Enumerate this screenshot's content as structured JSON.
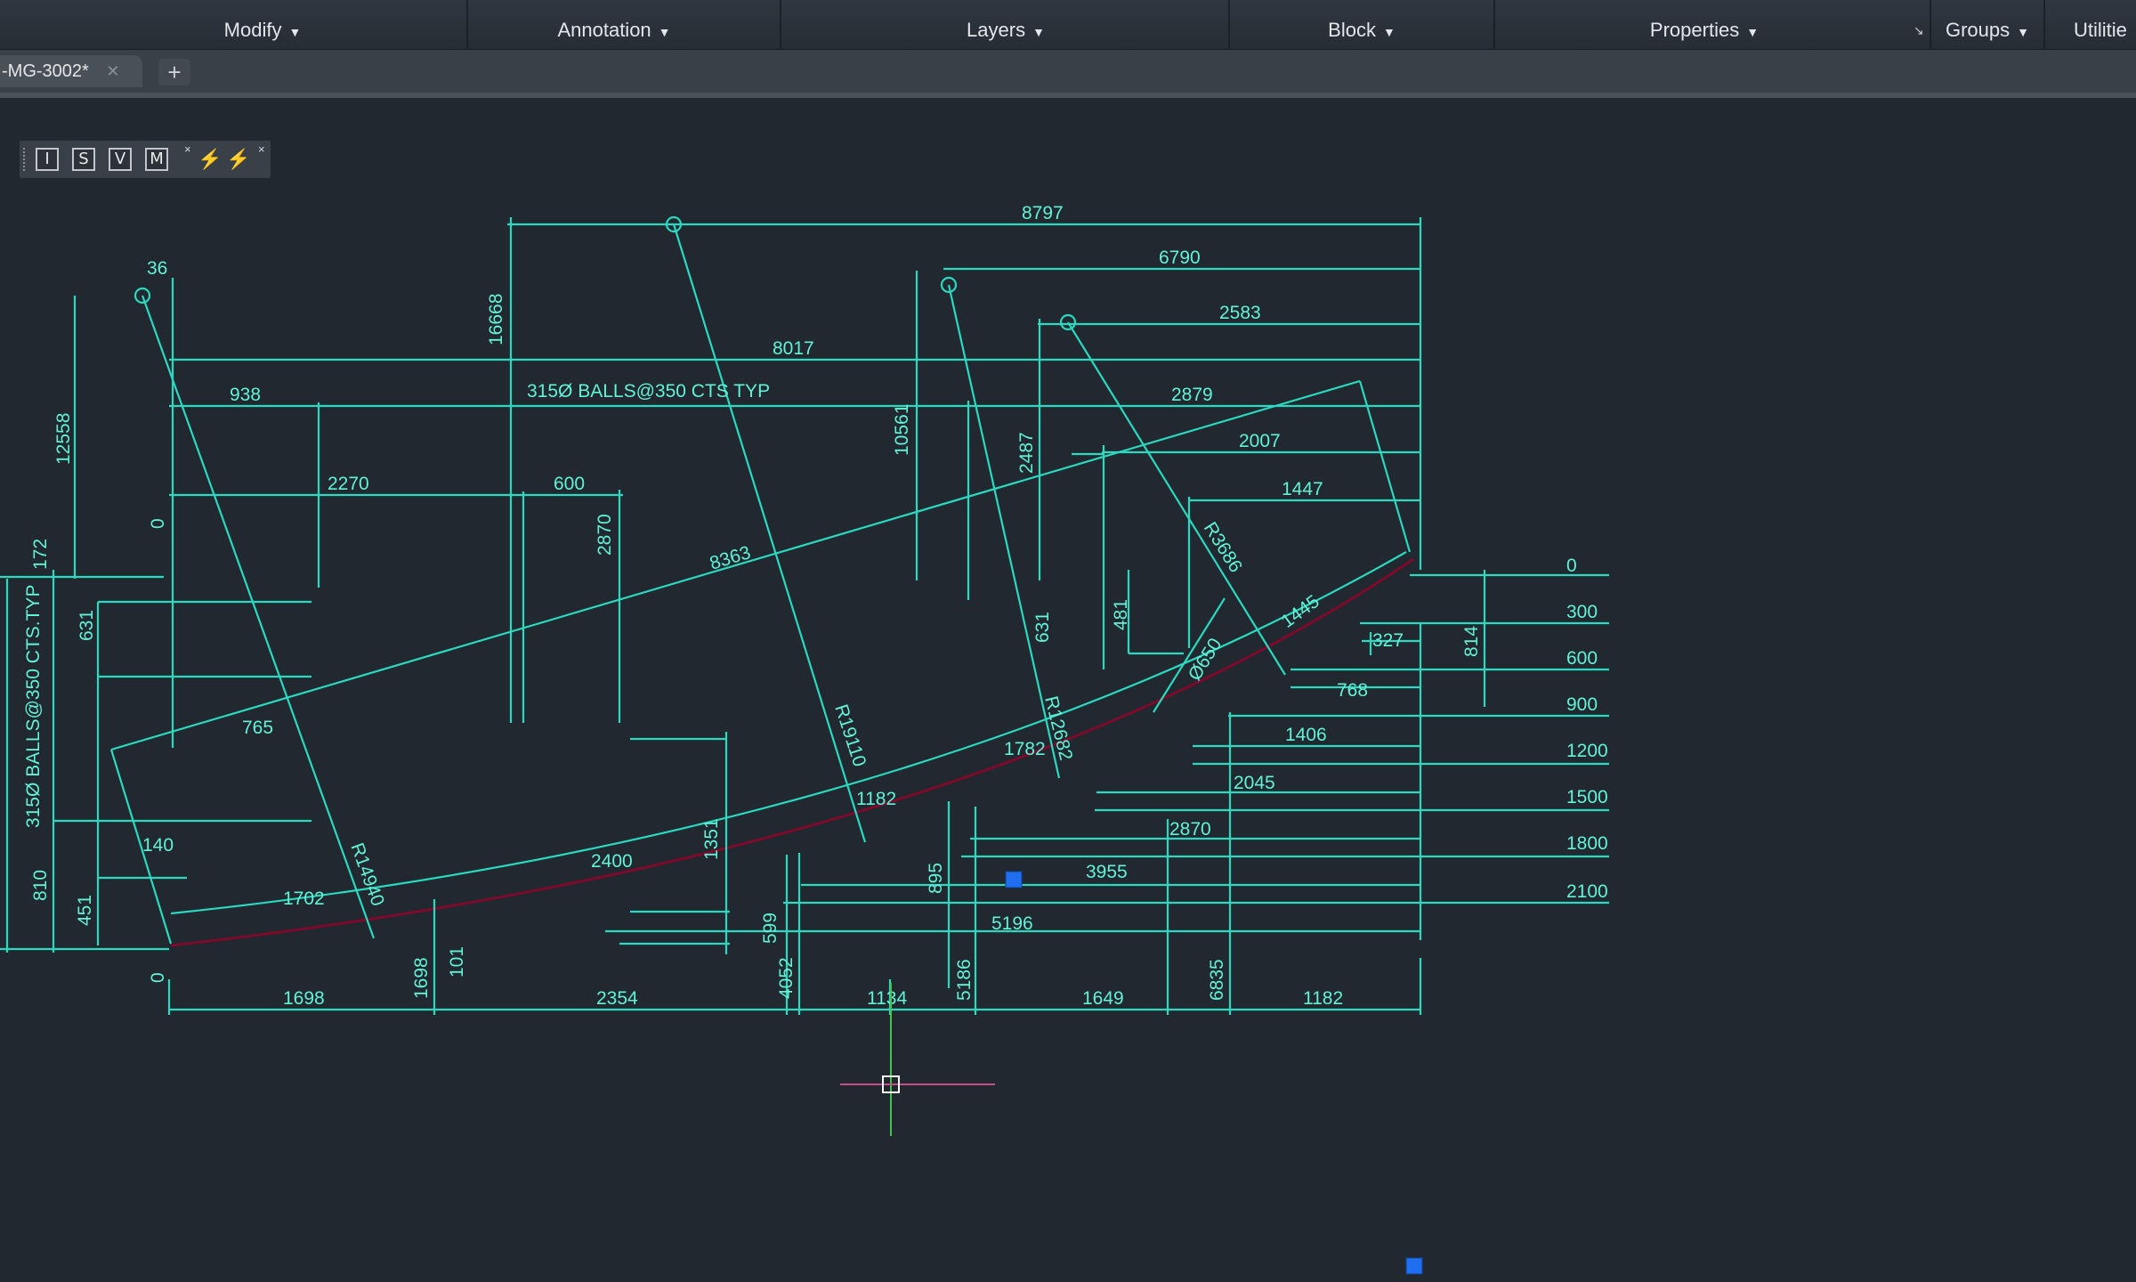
{
  "ribbon": {
    "panels": [
      {
        "label": "Modify"
      },
      {
        "label": "Annotation"
      },
      {
        "label": "Layers"
      },
      {
        "label": "Block"
      },
      {
        "label": "Properties"
      },
      {
        "label": "Groups"
      },
      {
        "label": "Utilitie"
      }
    ]
  },
  "tabs": {
    "document": "-MG-3002*",
    "close_glyph": "✕",
    "new_tab_glyph": "+"
  },
  "toolbar": {
    "buttons": [
      "I",
      "S",
      "V",
      "M"
    ],
    "close_glyph": "×"
  },
  "drawing": {
    "top_dims": [
      "36",
      "8797",
      "6790",
      "2583",
      "8017",
      "938",
      "2879",
      "2007",
      "1447",
      "2270",
      "600"
    ],
    "note": "315Ø BALLS@350 CTS TYP",
    "side_note": "315Ø BALLS@350 CTS.TYP",
    "vertical_dims": [
      "12558",
      "16668",
      "10561",
      "2487",
      "2870",
      "631",
      "631",
      "481",
      "814",
      "172",
      "810",
      "451",
      "1351",
      "895",
      "599",
      "4052",
      "5186",
      "6835",
      "1698",
      "101",
      "0",
      "0"
    ],
    "right_levels": [
      "0",
      "300",
      "600",
      "900",
      "1200",
      "1500",
      "1800",
      "2100"
    ],
    "offset_dims": [
      "327",
      "768",
      "1406",
      "2045",
      "2870",
      "3955",
      "5196"
    ],
    "radius_labels": [
      "R3686",
      "R19110",
      "R12682",
      "R14940"
    ],
    "diag_dim": "8363",
    "circle_dim": "Ø650",
    "ball_spacing": [
      "765",
      "140",
      "1702",
      "2400",
      "1182",
      "1782",
      "1445"
    ],
    "bottom_dims": [
      "1698",
      "2354",
      "1134",
      "1649",
      "1182"
    ]
  },
  "colors": {
    "background": "#212830",
    "dimension_lines": "#2ad9c0",
    "dimension_text": "#62f2d8",
    "edge_curve": "#7e0a2b",
    "grip": "#1f6ff0",
    "crosshair_vertical": "#49c04b",
    "crosshair_horizontal": "#c64d8a"
  }
}
